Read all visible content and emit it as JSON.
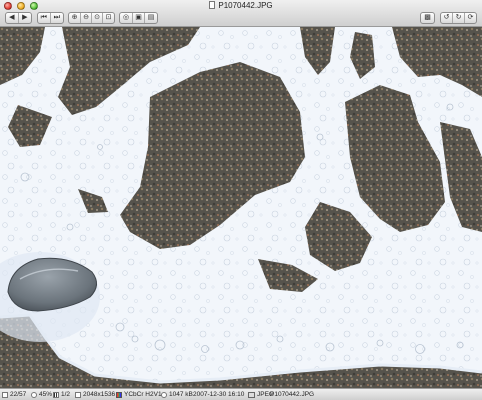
{
  "window": {
    "title": "P1070442.JPG"
  },
  "toolbar": {
    "nav": {
      "prev": "◀",
      "next": "▶"
    },
    "jump": {
      "first": "⏮",
      "last": "⏭"
    },
    "zoom": {
      "zoom_in": "⊕",
      "zoom_out": "⊖",
      "actual": "⊙",
      "fit": "⊡"
    },
    "view": {
      "slideshow": "◎",
      "single": "▣",
      "index": "▤"
    },
    "right": {
      "browser": "▩",
      "rotate_left": "↺",
      "rotate_right": "↻"
    }
  },
  "status": {
    "index": "22/57",
    "zoom": "45%",
    "page": "1/2",
    "dimensions": "2048x1536",
    "color": "YCbCr H2V1",
    "size": "1047 kB",
    "datetime": "2007-12-30 16:10",
    "format": "JPEG",
    "filename": "P1070442.JPG"
  },
  "colors": {
    "foam": "#f3f7fc",
    "sand": "#5d5a52",
    "stone": "#7d868e"
  },
  "icons": [
    "doc-icon",
    "prev-icon",
    "next-icon",
    "first-icon",
    "last-icon",
    "zoom-in-icon",
    "zoom-out-icon",
    "actual-size-icon",
    "fit-icon",
    "slideshow-icon",
    "single-view-icon",
    "index-view-icon",
    "browser-icon",
    "rotate-left-icon",
    "rotate-right-icon"
  ]
}
